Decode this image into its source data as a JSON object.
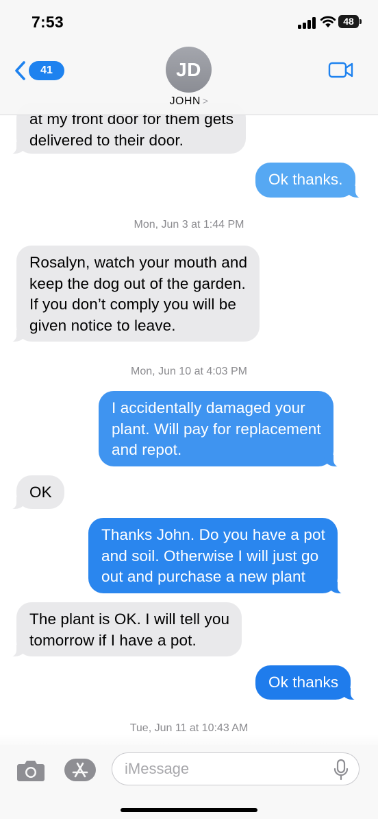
{
  "status_bar": {
    "time": "7:53",
    "battery": "48",
    "signal_icon": "cellular-signal-icon",
    "wifi_icon": "wifi-icon"
  },
  "header": {
    "back_count": "41",
    "avatar_initials": "JD",
    "contact_name": "JOHN",
    "name_chevron": ">",
    "video_icon": "video-camera-icon",
    "back_icon": "chevron-left-icon"
  },
  "conversation": {
    "partial_message_top_line": "at my front door for them gets",
    "partial_message_bottom_line": "delivered to their door.",
    "messages": [
      {
        "side": "out",
        "lines": [
          "Ok thanks."
        ]
      },
      {
        "side": "in",
        "lines": [
          "Rosalyn, watch your mouth and",
          "keep the dog out of the garden.",
          "If you don’t comply you will be",
          "given notice to leave."
        ]
      },
      {
        "side": "out",
        "lines": [
          "I accidentally damaged your",
          "plant. Will pay for replacement",
          "and repot."
        ]
      },
      {
        "side": "in",
        "lines": [
          "OK"
        ]
      },
      {
        "side": "out",
        "lines": [
          "Thanks John. Do you have a pot",
          "and soil. Otherwise I will just go",
          "out and purchase a new plant"
        ]
      },
      {
        "side": "in",
        "lines": [
          "The plant is OK.  I will tell you",
          "tomorrow if I have a pot."
        ]
      },
      {
        "side": "out",
        "lines": [
          "Ok thanks"
        ]
      }
    ],
    "timestamps": [
      {
        "day": "Mon, Jun 3",
        "time": "at 1:44 PM"
      },
      {
        "day": "Mon, Jun 10",
        "time": "at 4:03 PM"
      },
      {
        "day": "Tue, Jun 11",
        "time": "at 10:43 AM"
      }
    ]
  },
  "input_bar": {
    "placeholder": "iMessage",
    "camera_icon": "camera-icon",
    "apps_icon": "app-store-icon",
    "mic_icon": "microphone-icon"
  },
  "colors": {
    "outgoing_bubble": "#1e82ef",
    "incoming_bubble": "#e9e9eb",
    "accent": "#1e82ef"
  }
}
